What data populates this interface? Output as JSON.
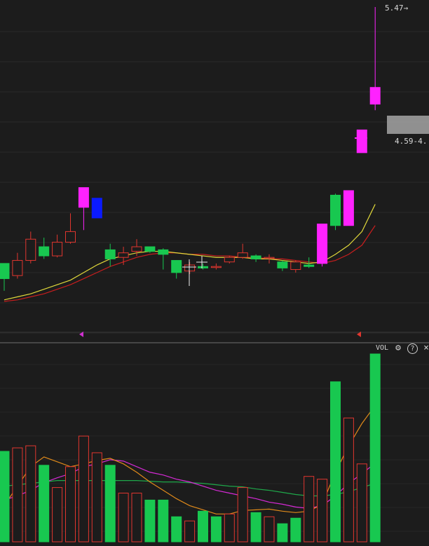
{
  "chart_data": [
    {
      "type": "candlestick",
      "panel": "price",
      "high_marker": "5.47",
      "current_label": "4.59-4.",
      "candles": [
        {
          "o": 3.68,
          "h": 3.71,
          "l": 3.6,
          "c": 3.78,
          "up": false
        },
        {
          "o": 3.7,
          "h": 3.85,
          "l": 3.68,
          "c": 3.8,
          "up": true
        },
        {
          "o": 3.8,
          "h": 3.99,
          "l": 3.78,
          "c": 3.94,
          "up": true
        },
        {
          "o": 3.89,
          "h": 3.95,
          "l": 3.81,
          "c": 3.83,
          "up": false
        },
        {
          "o": 3.83,
          "h": 3.97,
          "l": 3.82,
          "c": 3.92,
          "up": true
        },
        {
          "o": 3.92,
          "h": 4.11,
          "l": 3.91,
          "c": 3.99,
          "up": true
        },
        {
          "o": 4.15,
          "h": 4.28,
          "l": 4.0,
          "c": 4.28,
          "up": true
        },
        {
          "o": 4.21,
          "h": 4.21,
          "l": 4.08,
          "c": 4.08,
          "up": false,
          "color": "blue"
        },
        {
          "o": 3.87,
          "h": 3.91,
          "l": 3.76,
          "c": 3.81,
          "up": false
        },
        {
          "o": 3.82,
          "h": 3.89,
          "l": 3.77,
          "c": 3.85,
          "up": true
        },
        {
          "o": 3.86,
          "h": 3.94,
          "l": 3.83,
          "c": 3.89,
          "up": true
        },
        {
          "o": 3.89,
          "h": 3.89,
          "l": 3.85,
          "c": 3.86,
          "up": false
        },
        {
          "o": 3.87,
          "h": 3.88,
          "l": 3.74,
          "c": 3.84,
          "up": false
        },
        {
          "o": 3.8,
          "h": 3.8,
          "l": 3.68,
          "c": 3.72,
          "up": false
        },
        {
          "o": 3.73,
          "h": 3.79,
          "l": 3.71,
          "c": 3.77,
          "up": true
        },
        {
          "o": 3.76,
          "h": 3.78,
          "l": 3.74,
          "c": 3.75,
          "up": false
        },
        {
          "o": 3.76,
          "h": 3.78,
          "l": 3.74,
          "c": 3.76,
          "up": true
        },
        {
          "o": 3.79,
          "h": 3.83,
          "l": 3.78,
          "c": 3.82,
          "up": true
        },
        {
          "o": 3.82,
          "h": 3.91,
          "l": 3.81,
          "c": 3.85,
          "up": true
        },
        {
          "o": 3.83,
          "h": 3.84,
          "l": 3.79,
          "c": 3.81,
          "up": false
        },
        {
          "o": 3.82,
          "h": 3.84,
          "l": 3.78,
          "c": 3.82,
          "up": true
        },
        {
          "o": 3.79,
          "h": 3.8,
          "l": 3.73,
          "c": 3.75,
          "up": false
        },
        {
          "o": 3.74,
          "h": 3.8,
          "l": 3.72,
          "c": 3.79,
          "up": true
        },
        {
          "o": 3.77,
          "h": 3.82,
          "l": 3.75,
          "c": 3.76,
          "up": false
        },
        {
          "o": 3.78,
          "h": 4.04,
          "l": 3.76,
          "c": 4.04,
          "up": true
        },
        {
          "o": 4.23,
          "h": 4.24,
          "l": 4.0,
          "c": 4.03,
          "up": false
        },
        {
          "o": 4.03,
          "h": 4.26,
          "l": 4.03,
          "c": 4.26,
          "up": true
        },
        {
          "o": 4.51,
          "h": 4.66,
          "l": 4.51,
          "c": 4.66,
          "up": true
        },
        {
          "o": 4.83,
          "h": 5.47,
          "l": 4.79,
          "c": 4.94,
          "up": false
        }
      ],
      "ma_yellow": [
        3.54,
        3.56,
        3.58,
        3.61,
        3.64,
        3.67,
        3.72,
        3.77,
        3.81,
        3.83,
        3.85,
        3.86,
        3.86,
        3.85,
        3.84,
        3.83,
        3.82,
        3.82,
        3.82,
        3.81,
        3.81,
        3.8,
        3.79,
        3.78,
        3.79,
        3.84,
        3.9,
        3.99,
        4.17
      ],
      "ma_red": [
        3.53,
        3.54,
        3.56,
        3.58,
        3.61,
        3.64,
        3.68,
        3.72,
        3.76,
        3.79,
        3.82,
        3.84,
        3.85,
        3.85,
        3.84,
        3.84,
        3.83,
        3.83,
        3.82,
        3.82,
        3.81,
        3.81,
        3.8,
        3.79,
        3.78,
        3.8,
        3.84,
        3.9,
        4.03
      ]
    },
    {
      "type": "bar",
      "panel": "volume",
      "title": "VOL",
      "values": [
        130,
        135,
        138,
        110,
        78,
        108,
        152,
        128,
        110,
        70,
        70,
        60,
        60,
        36,
        30,
        44,
        36,
        40,
        78,
        42,
        36,
        26,
        34,
        94,
        90,
        230,
        178,
        112,
        270
      ],
      "up": [
        false,
        true,
        true,
        false,
        true,
        true,
        true,
        true,
        false,
        true,
        true,
        false,
        false,
        false,
        true,
        false,
        false,
        true,
        true,
        false,
        true,
        false,
        false,
        true,
        true,
        false,
        true,
        true,
        false
      ],
      "ma_orange": [
        52,
        80,
        108,
        122,
        115,
        108,
        112,
        117,
        120,
        112,
        100,
        86,
        74,
        62,
        52,
        46,
        40,
        40,
        45,
        46,
        47,
        44,
        42,
        44,
        54,
        100,
        138,
        170,
        196
      ],
      "ma_magenta": [
        60,
        66,
        74,
        85,
        92,
        98,
        108,
        112,
        118,
        116,
        108,
        100,
        96,
        90,
        86,
        80,
        74,
        70,
        66,
        62,
        57,
        54,
        50,
        48,
        52,
        66,
        84,
        98,
        113
      ],
      "ma_green": [
        80,
        82,
        84,
        86,
        88,
        88,
        88,
        88,
        88,
        88,
        88,
        87,
        86,
        86,
        85,
        84,
        82,
        80,
        79,
        76,
        74,
        71,
        68,
        66,
        66,
        68,
        72,
        78,
        84
      ]
    }
  ],
  "tools": {
    "gear_icon": "gear",
    "help_icon": "?",
    "close_icon": "×"
  }
}
